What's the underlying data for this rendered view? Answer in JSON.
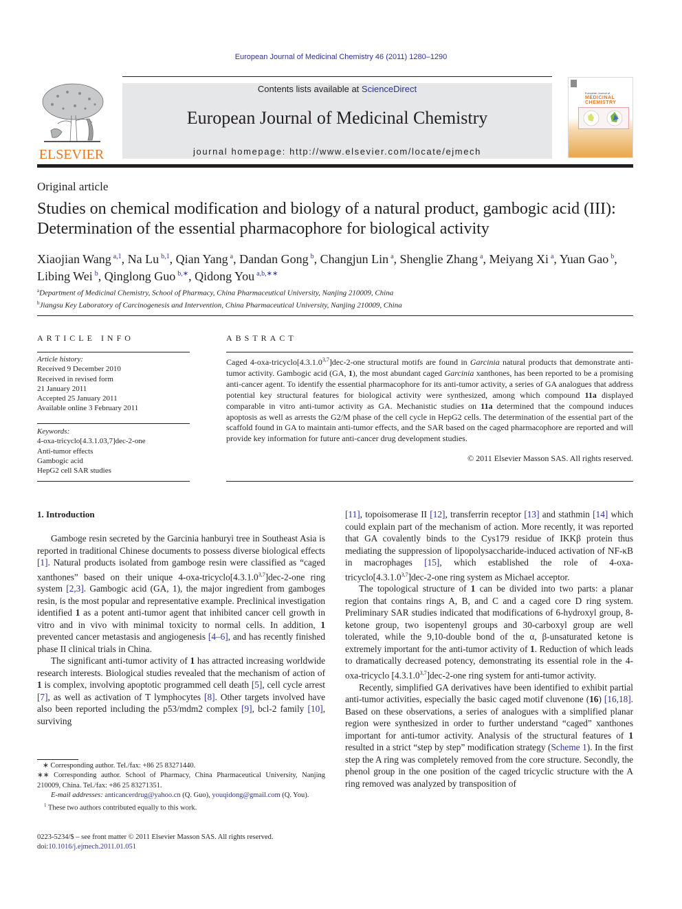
{
  "header": {
    "citation": "European Journal of Medicinal Chemistry 46 (2011) 1280–1290",
    "publisher_logo_text": "ELSEVIER",
    "contents_prefix": "Contents lists available at ",
    "contents_link": "ScienceDirect",
    "journal_title": "European Journal of Medicinal Chemistry",
    "homepage": "journal homepage: http://www.elsevier.com/locate/ejmech",
    "cover": {
      "subtitle": "European Journal of",
      "title_line1": "MEDICINAL",
      "title_line2": "CHEMISTRY"
    }
  },
  "article": {
    "type": "Original article",
    "title": "Studies on chemical modification and biology of a natural product, gambogic acid (III): Determination of the essential pharmacophore for biological activity",
    "authors": [
      {
        "name": "Xiaojian Wang",
        "aff": "a,1",
        "sep": ", "
      },
      {
        "name": "Na Lu",
        "aff": "b,1",
        "sep": ", "
      },
      {
        "name": "Qian Yang",
        "aff": "a",
        "sep": ", "
      },
      {
        "name": "Dandan Gong",
        "aff": "b",
        "sep": ", "
      },
      {
        "name": "Changjun Lin",
        "aff": "a",
        "sep": ", "
      },
      {
        "name": "Shenglie Zhang",
        "aff": "a",
        "sep": ", "
      },
      {
        "name": "Meiyang Xi",
        "aff": "a",
        "sep": ", "
      },
      {
        "name": "Yuan Gao",
        "aff": "b",
        "sep": ", "
      },
      {
        "name": "Libing Wei",
        "aff": "b",
        "sep": ", "
      },
      {
        "name": "Qinglong Guo",
        "aff": "b,∗",
        "sep": ", "
      },
      {
        "name": "Qidong You",
        "aff": "a,b,∗∗",
        "sep": ""
      }
    ],
    "affiliations": [
      {
        "key": "a",
        "text": "Department of Medicinal Chemistry, School of Pharmacy, China Pharmaceutical University, Nanjing 210009, China"
      },
      {
        "key": "b",
        "text": "Jiangsu Key Laboratory of Carcinogenesis and Intervention, China Pharmaceutical University, Nanjing 210009, China"
      }
    ]
  },
  "article_info": {
    "heading": "ARTICLE INFO",
    "history_label": "Article history:",
    "history": [
      "Received 9 December 2010",
      "Received in revised form",
      "21 January 2011",
      "Accepted 25 January 2011",
      "Available online 3 February 2011"
    ],
    "keywords_label": "Keywords:",
    "keywords": [
      "4-oxa-tricyclo[4.3.1.03,7]dec-2-one",
      "Anti-tumor effects",
      "Gambogic acid",
      "HepG2 cell SAR studies"
    ]
  },
  "abstract": {
    "heading": "ABSTRACT",
    "segments": [
      {
        "t": "Caged 4-oxa-tricyclo[4.3.1.0"
      },
      {
        "t": "3,7",
        "sup": true
      },
      {
        "t": "]dec-2-one structural motifs are found in "
      },
      {
        "t": "Garcinia",
        "i": true
      },
      {
        "t": " natural products that demonstrate anti-tumor activity. Gambogic acid (GA, "
      },
      {
        "t": "1",
        "b": true
      },
      {
        "t": "), the most abundant caged "
      },
      {
        "t": "Garcinia",
        "i": true
      },
      {
        "t": " xanthones, has been reported to be a promising anti-cancer agent. To identify the essential pharmacophore for its anti-tumor activity, a series of GA analogues that address potential key structural features for biological activity were synthesized, among which compound "
      },
      {
        "t": "11a",
        "b": true
      },
      {
        "t": " displayed comparable in vitro anti-tumor activity as GA. Mechanistic studies on "
      },
      {
        "t": "11a",
        "b": true
      },
      {
        "t": " determined that the compound induces apoptosis as well as arrests the G2/M phase of the cell cycle in HepG2 cells. The determination of the essential part of the scaffold found in GA to maintain anti-tumor effects, and the SAR based on the caged pharmacophore are reported and will provide key information for future anti-cancer drug development studies."
      }
    ],
    "copyright": "© 2011 Elsevier Masson SAS. All rights reserved."
  },
  "body": {
    "section_heading": "1.  Introduction",
    "left_paragraphs": [
      [
        {
          "t": "Gamboge resin secreted by the Garcinia hanburyi tree in Southeast Asia is reported in traditional Chinese documents to possess diverse biological effects "
        },
        {
          "t": "[1]",
          "link": true
        },
        {
          "t": ". Natural products isolated from gamboge resin were classified as “caged xanthones” based on their unique 4-oxa-tricyclo[4.3.1.0"
        },
        {
          "t": "3,7",
          "sup": true
        },
        {
          "t": "]dec-2-one ring system "
        },
        {
          "t": "[2,3]",
          "link": true
        },
        {
          "t": ". Gambogic acid (GA, 1), the major ingredient from gamboges resin, is the most popular and representative example. Preclinical investigation identified "
        },
        {
          "t": "1",
          "b": true
        },
        {
          "t": " as a potent anti-tumor agent that inhibited cancer cell growth in vitro and in vivo with minimal toxicity to normal cells. In addition, "
        },
        {
          "t": "1",
          "b": true
        },
        {
          "t": " prevented cancer metastasis and angiogenesis "
        },
        {
          "t": "[4–6]",
          "link": true
        },
        {
          "t": ", and has recently finished phase II clinical trials in China."
        }
      ],
      [
        {
          "t": "The significant anti-tumor activity of "
        },
        {
          "t": "1",
          "b": true
        },
        {
          "t": " has attracted increasing worldwide research interests. Biological studies revealed that the mechanism of action of "
        },
        {
          "t": "1",
          "b": true
        },
        {
          "t": " is complex, involving apoptotic programmed cell death "
        },
        {
          "t": "[5]",
          "link": true
        },
        {
          "t": ", cell cycle arrest "
        },
        {
          "t": "[7]",
          "link": true
        },
        {
          "t": ", as well as activation of T lymphocytes "
        },
        {
          "t": "[8]",
          "link": true
        },
        {
          "t": ". Other targets involved have also been reported including the p53/mdm2 complex "
        },
        {
          "t": "[9]",
          "link": true
        },
        {
          "t": ", bcl-2 family "
        },
        {
          "t": "[10]",
          "link": true
        },
        {
          "t": ", surviving"
        }
      ]
    ],
    "right_paragraphs": [
      [
        {
          "t": "[11]",
          "link": true
        },
        {
          "t": ", topoisomerase II "
        },
        {
          "t": "[12]",
          "link": true
        },
        {
          "t": ", transferrin receptor "
        },
        {
          "t": "[13]",
          "link": true
        },
        {
          "t": " and stathmin "
        },
        {
          "t": "[14]",
          "link": true
        },
        {
          "t": " which could explain part of the mechanism of action. More recently, it was reported that GA covalently binds to the Cys179 residue of IKKβ protein thus mediating the suppression of lipopolysaccharide-induced activation of NF-κB in macrophages "
        },
        {
          "t": "[15]",
          "link": true
        },
        {
          "t": ", which established the role of 4-oxa-tricyclo[4.3.1.0"
        },
        {
          "t": "3,7",
          "sup": true
        },
        {
          "t": "]dec-2-one ring system as Michael acceptor."
        }
      ],
      [
        {
          "t": "The topological structure of "
        },
        {
          "t": "1",
          "b": true
        },
        {
          "t": " can be divided into two parts: a planar region that contains rings A, B, and C and a caged core D ring system. Preliminary SAR studies indicated that modifications of 6-hydroxyl group, 8-ketone group, two isopentenyl groups and 30-carboxyl group are well tolerated, while the 9,10-double bond of the α, β-unsaturated ketone is extremely important for the anti-tumor activity of "
        },
        {
          "t": "1",
          "b": true
        },
        {
          "t": ". Reduction of which leads to dramatically decreased potency, demonstrating its essential role in the 4-oxa-tricyclo [4.3.1.0"
        },
        {
          "t": "3,7",
          "sup": true
        },
        {
          "t": "]dec-2-one ring system for anti-tumor activity."
        }
      ],
      [
        {
          "t": "Recently, simplified GA derivatives have been identified to exhibit partial anti-tumor activities, especially the basic caged motif cluvenone ("
        },
        {
          "t": "16",
          "b": true
        },
        {
          "t": ") "
        },
        {
          "t": "[16,18]",
          "link": true
        },
        {
          "t": ". Based on these observations, a series of analogues with a simplified planar region were synthesized in order to further understand “caged” xanthones important for anti-tumor activity. Analysis of the structural features of "
        },
        {
          "t": "1",
          "b": true
        },
        {
          "t": " resulted in a strict “step by step” modification strategy ("
        },
        {
          "t": "Scheme 1",
          "link": true
        },
        {
          "t": "). In the first step the A ring was completely removed from the core structure. Secondly, the phenol group in the one position of the caged tricyclic structure with the A ring removed was analyzed by transposition of"
        }
      ]
    ]
  },
  "footnotes": {
    "corr1": "∗  Corresponding author. Tel./fax: +86 25 83271440.",
    "corr2": "∗∗  Corresponding author. School of Pharmacy, China Pharmaceutical University, Nanjing 210009, China. Tel./fax: +86 25 83271351.",
    "email_label": "E-mail addresses:",
    "email1": "anticancerdrug@yahoo.cn",
    "email1_owner": " (Q. Guo), ",
    "email2": "youqidong@gmail.com",
    "email2_owner": " (Q. You).",
    "equal_marker": "1",
    "equal_text": "  These two authors contributed equally to this work."
  },
  "front_matter": {
    "issn_line": "0223-5234/$ – see front matter © 2011 Elsevier Masson SAS. All rights reserved.",
    "doi_label": "doi:",
    "doi": "10.1016/j.ejmech.2011.01.051"
  },
  "colors": {
    "link": "#2e3192",
    "elsevier_orange": "#e87722",
    "masthead_gray": "#e6e7e8",
    "text": "#231f20"
  }
}
